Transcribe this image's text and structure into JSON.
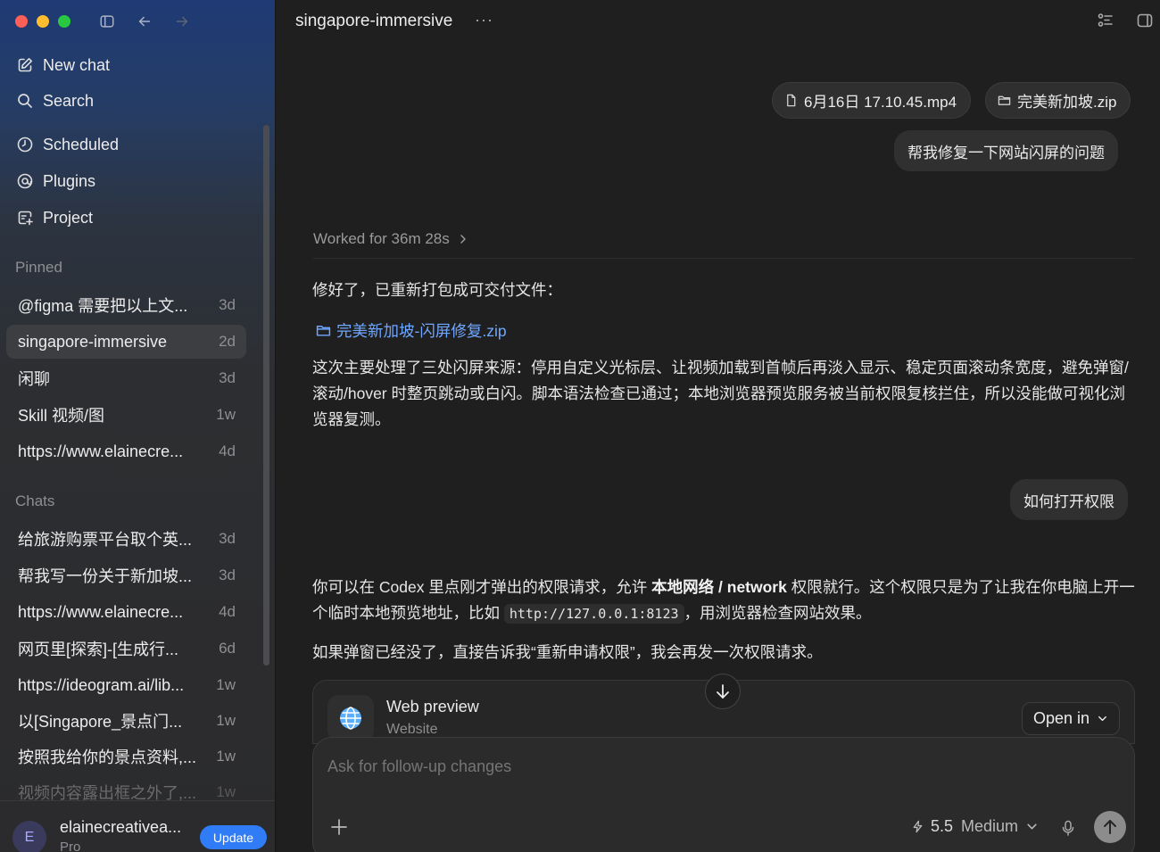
{
  "sidebar": {
    "nav": [
      {
        "label": "New chat",
        "icon": "compose-icon"
      },
      {
        "label": "Search",
        "icon": "search-icon"
      },
      {
        "label": "Scheduled",
        "icon": "clock-icon"
      },
      {
        "label": "Plugins",
        "icon": "plugin-icon"
      },
      {
        "label": "Project",
        "icon": "project-icon"
      }
    ],
    "pinned_title": "Pinned",
    "pinned": [
      {
        "label": "@figma 需要把以上文...",
        "age": "3d"
      },
      {
        "label": "singapore-immersive",
        "age": "2d",
        "active": true
      },
      {
        "label": "闲聊",
        "age": "3d"
      },
      {
        "label": "Skill 视频/图",
        "age": "1w"
      },
      {
        "label": "https://www.elainecre...",
        "age": "4d"
      }
    ],
    "chats_title": "Chats",
    "chats": [
      {
        "label": "给旅游购票平台取个英...",
        "age": "3d"
      },
      {
        "label": "帮我写一份关于新加坡...",
        "age": "3d"
      },
      {
        "label": "https://www.elainecre...",
        "age": "4d"
      },
      {
        "label": "网页里[探索]-[生成行...",
        "age": "6d"
      },
      {
        "label": "https://ideogram.ai/lib...",
        "age": "1w"
      },
      {
        "label": "以[Singapore_景点门...",
        "age": "1w"
      },
      {
        "label": "按照我给你的景点资料,...",
        "age": "1w"
      },
      {
        "label": "视频内容露出框之外了,...",
        "age": "1w"
      }
    ],
    "user": {
      "avatar_letter": "E",
      "name": "elainecreativea...",
      "plan": "Pro",
      "update_label": "Update"
    }
  },
  "header": {
    "title": "singapore-immersive",
    "more": "···"
  },
  "conversation": {
    "attachments": [
      {
        "label": "6月16日 17.10.45.mp4",
        "icon": "file-icon"
      },
      {
        "label": "完美新加坡.zip",
        "icon": "folder-icon"
      }
    ],
    "user_msg_1": "帮我修复一下网站闪屏的问题",
    "worked": "Worked for 36m 28s",
    "reply_1": "修好了，已重新打包成可交付文件：",
    "reply_file": "完美新加坡-闪屏修复.zip",
    "reply_2": "这次主要处理了三处闪屏来源：停用自定义光标层、让视频加载到首帧后再淡入显示、稳定页面滚动条宽度，避免弹窗/滚动/hover 时整页跳动或白闪。脚本语法检查已通过；本地浏览器预览服务被当前权限复核拦住，所以没能做可视化浏览器复测。",
    "user_msg_2": "如何打开权限",
    "reply_3_a": "你可以在 Codex 里点刚才弹出的权限请求，允许 ",
    "reply_3_bold": "本地网络 / network",
    "reply_3_b": " 权限就行。这个权限只是为了让我在你电脑上开一个临时本地预览地址，比如 ",
    "reply_3_code": "http://127.0.0.1:8123",
    "reply_3_c": "，用浏览器检查网站效果。",
    "reply_4": "如果弹窗已经没了，直接告诉我“重新申请权限”，我会再发一次权限请求。"
  },
  "preview": {
    "title": "Web preview",
    "subtitle": "Website",
    "open_in": "Open in"
  },
  "composer": {
    "placeholder": "Ask for follow-up changes",
    "model": "5.5",
    "effort": "Medium"
  },
  "colors": {
    "accent": "#2f7cf6",
    "link": "#6fa6ff"
  }
}
